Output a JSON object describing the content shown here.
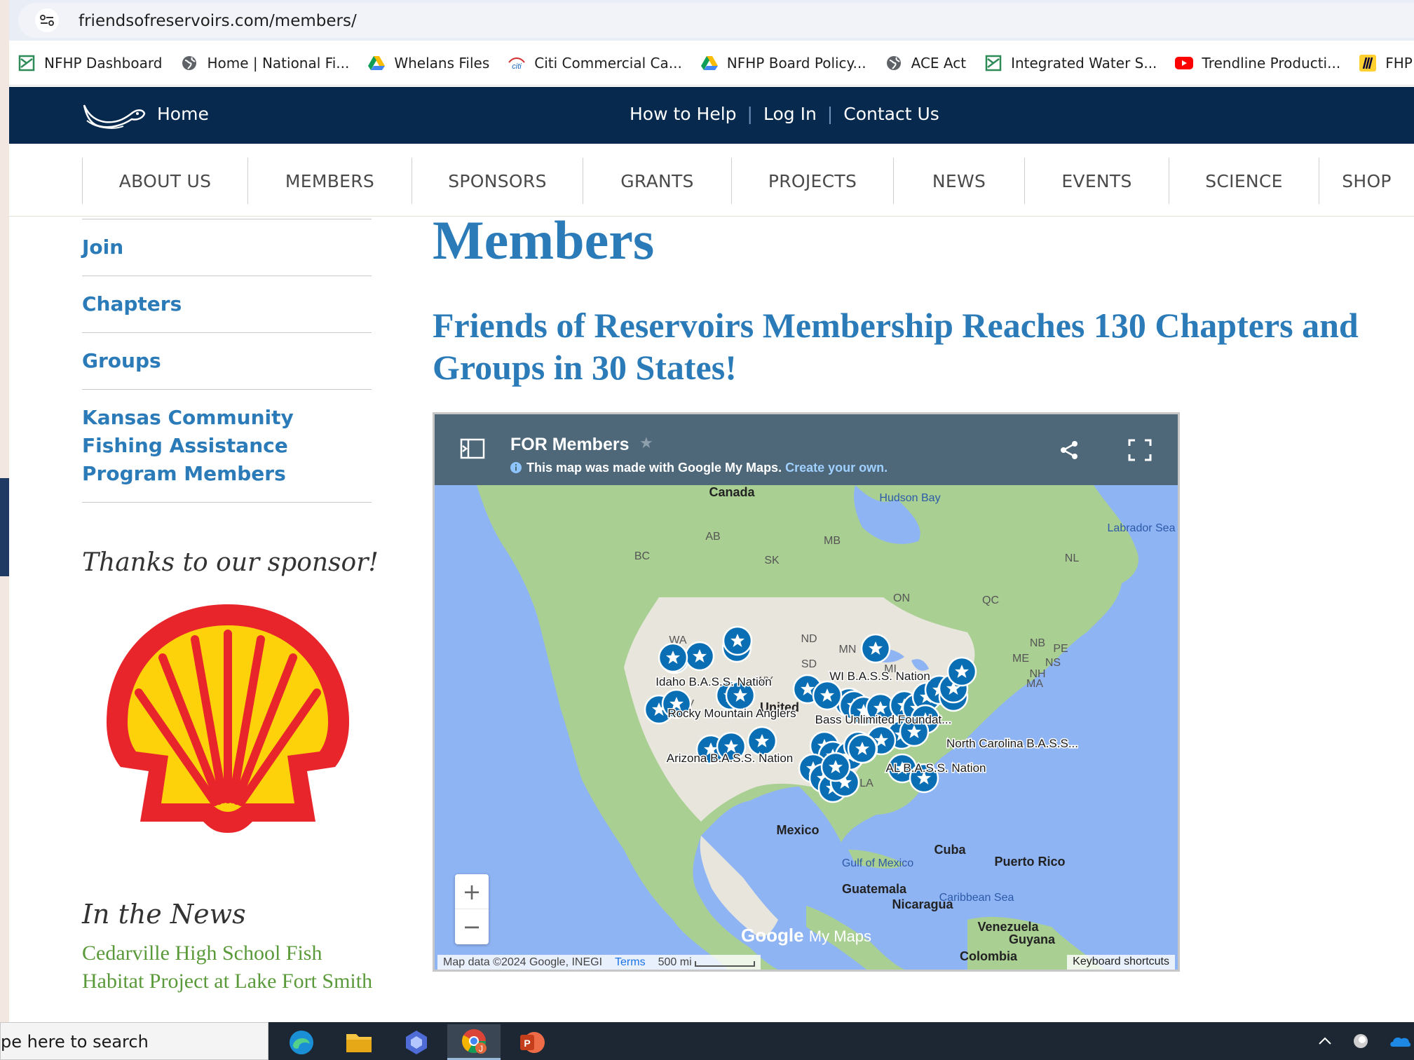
{
  "browser": {
    "url": "friendsofreservoirs.com/members/",
    "bookmarks": [
      {
        "label": "NFHP Dashboard",
        "icon": "nfhp-icon"
      },
      {
        "label": "Home | National Fi...",
        "icon": "globe-icon"
      },
      {
        "label": "Whelans Files",
        "icon": "google-drive-icon"
      },
      {
        "label": "Citi Commercial Ca...",
        "icon": "citi-icon"
      },
      {
        "label": "NFHP Board Policy...",
        "icon": "google-drive-icon"
      },
      {
        "label": "ACE Act",
        "icon": "globe-icon"
      },
      {
        "label": "Integrated Water S...",
        "icon": "nfhp-icon"
      },
      {
        "label": "Trendline Producti...",
        "icon": "youtube-icon"
      },
      {
        "label": "FHP Coordinators,",
        "icon": "miro-icon"
      }
    ]
  },
  "site": {
    "home_label": "Home",
    "top_links": [
      "How to Help",
      "Log In",
      "Contact Us"
    ],
    "nav": [
      "ABOUT US",
      "MEMBERS",
      "SPONSORS",
      "GRANTS",
      "PROJECTS",
      "NEWS",
      "EVENTS",
      "SCIENCE",
      "SHOP"
    ]
  },
  "sidebar": {
    "links": [
      "Join",
      "Chapters",
      "Groups",
      "Kansas Community Fishing Assistance Program Members"
    ],
    "sponsor_heading": "Thanks to our sponsor!",
    "news_heading": "In the News",
    "news_link": "Cedarville High School Fish Habitat Project at Lake Fort Smith"
  },
  "main": {
    "title": "Members",
    "subtitle": "Friends of Reservoirs Membership Reaches 130 Chapters and Groups in 30 States!"
  },
  "map": {
    "title": "FOR Members",
    "note": "This map was made with Google My Maps.",
    "create_link": "Create your own.",
    "region_labels": [
      "Canada",
      "Hudson Bay",
      "Labrador Sea",
      "AB",
      "MB",
      "SK",
      "BC",
      "NL",
      "ON",
      "QC",
      "NB",
      "PE",
      "NS",
      "ME",
      "NH",
      "MA",
      "WA",
      "ND",
      "MN",
      "SD",
      "MI",
      "WY",
      "NV",
      "LA",
      "United",
      "Mexico",
      "Gulf of Mexico",
      "Cuba",
      "Puerto Rico",
      "Guatemala",
      "Caribbean Sea",
      "Nicaragua",
      "Venezuela",
      "Guyana",
      "Colombia"
    ],
    "marker_labels": [
      "Idaho B.A.S.S. Nation",
      "Rocky Mountain Anglers",
      "Arizona B.A.S.S. Nation",
      "WI B.A.S.S. Nation",
      "Bass Unlimited Foundat...",
      "North Carolina B.A.S.S...",
      "AL B.A.S.S. Nation"
    ],
    "zoom_in": "+",
    "zoom_out": "−",
    "attribution": "Map data ©2024 Google, INEGI",
    "terms": "Terms",
    "scale": "500 mi",
    "keyboard": "Keyboard shortcuts",
    "logo_google": "Google",
    "logo_mymaps": "My Maps",
    "marker_color": "#0a6eb4"
  },
  "taskbar": {
    "search_placeholder": "pe here to search",
    "apps": [
      "edge-icon",
      "file-explorer-icon",
      "copilot-icon",
      "chrome-icon",
      "powerpoint-icon"
    ]
  }
}
